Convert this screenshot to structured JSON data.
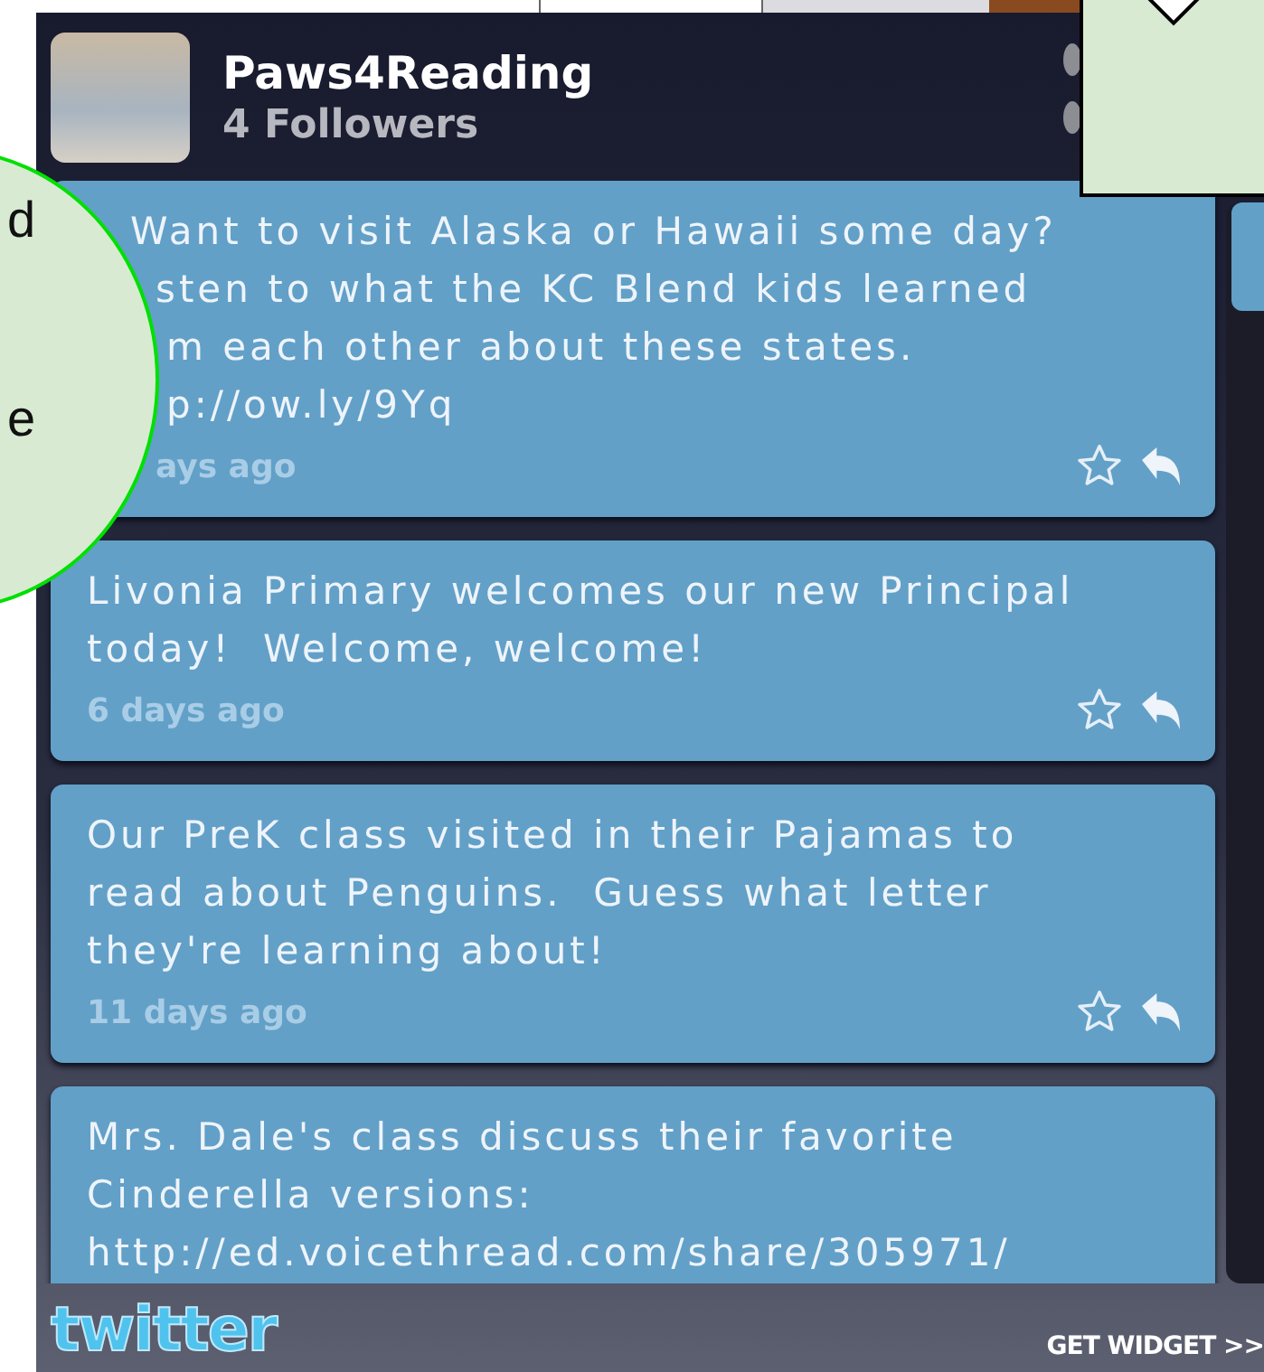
{
  "profile": {
    "name": "Paws4Reading",
    "followers": "4 Followers"
  },
  "tweets": [
    {
      "lines": [
        "Want to visit Alaska or Hawaii some day?",
        "sten to what the KC Blend kids learned",
        "m each other about these states.",
        "p://ow.ly/9Yq"
      ],
      "time": "ays ago"
    },
    {
      "lines": [
        "Livonia Primary welcomes our new Principal",
        "today!  Welcome, welcome!"
      ],
      "time": "6 days ago"
    },
    {
      "lines": [
        "Our PreK class visited in their Pajamas to",
        "read about Penguins.  Guess what letter",
        "they're learning about!"
      ],
      "time": "11 days ago"
    },
    {
      "lines": [
        "Mrs. Dale's class discuss their favorite",
        "Cinderella versions:",
        "http://ed.voicethread.com/share/305971/"
      ]
    }
  ],
  "footer": {
    "logo": "twitter",
    "link": "GET WIDGET >>"
  },
  "callout_ellipse": {
    "lines": [
      "d",
      "e"
    ]
  }
}
